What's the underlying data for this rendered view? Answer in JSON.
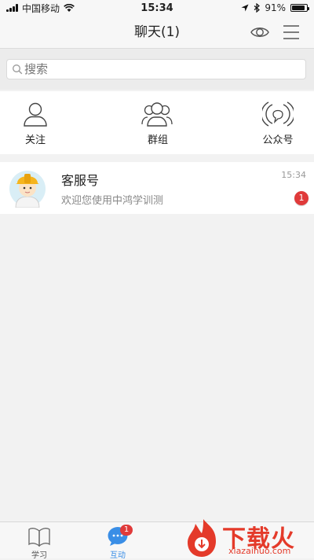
{
  "status_bar": {
    "carrier": "中国移动",
    "time": "15:34",
    "battery": "91%",
    "battery_level": 0.91
  },
  "header": {
    "title": "聊天(1)",
    "eye_icon": "eye-icon",
    "menu_icon": "menu-icon"
  },
  "search": {
    "placeholder": "搜索"
  },
  "quick_actions": [
    {
      "label": "关注",
      "icon": "person-icon"
    },
    {
      "label": "群组",
      "icon": "group-icon"
    },
    {
      "label": "公众号",
      "icon": "broadcast-icon"
    }
  ],
  "chats": [
    {
      "name": "客服号",
      "preview": "欢迎您使用中鸿学训测",
      "time": "15:34",
      "unread": "1"
    }
  ],
  "tabs": [
    {
      "label": "学习",
      "icon": "book-icon"
    },
    {
      "label": "互动",
      "icon": "chat-bubble-icon",
      "badge": "1"
    }
  ],
  "colors": {
    "accent": "#3a8ee6",
    "badge": "#e03a3a",
    "watermark": "#e43a2a"
  },
  "watermark": {
    "text": "下载火",
    "sub": "xiazaihuo.com"
  }
}
